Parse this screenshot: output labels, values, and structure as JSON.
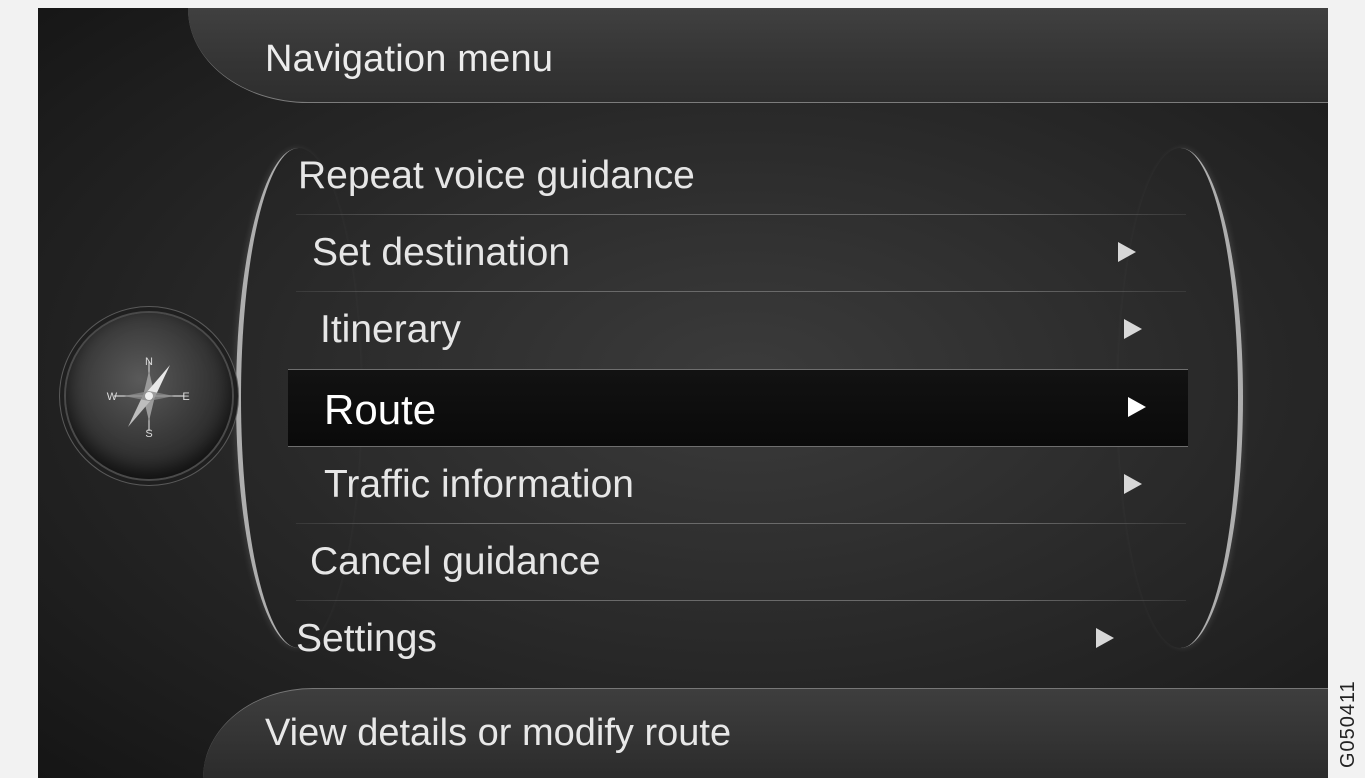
{
  "header": {
    "title": "Navigation menu"
  },
  "menu": {
    "items": [
      {
        "label": "Repeat voice guidance",
        "has_submenu": false,
        "selected": false
      },
      {
        "label": "Set destination",
        "has_submenu": true,
        "selected": false
      },
      {
        "label": "Itinerary",
        "has_submenu": true,
        "selected": false
      },
      {
        "label": "Route",
        "has_submenu": true,
        "selected": true
      },
      {
        "label": "Traffic information",
        "has_submenu": true,
        "selected": false
      },
      {
        "label": "Cancel guidance",
        "has_submenu": false,
        "selected": false
      },
      {
        "label": "Settings",
        "has_submenu": true,
        "selected": false
      }
    ]
  },
  "footer": {
    "hint": "View details or modify route"
  },
  "compass": {
    "icon": "compass-icon",
    "labels": {
      "n": "N",
      "e": "E",
      "s": "S",
      "w": "W"
    }
  },
  "watermark": "G050411",
  "colors": {
    "background": "#2a2a2a",
    "text": "#e6e6e6",
    "selected_bg": "#0d0d0d",
    "selected_text": "#ffffff"
  }
}
